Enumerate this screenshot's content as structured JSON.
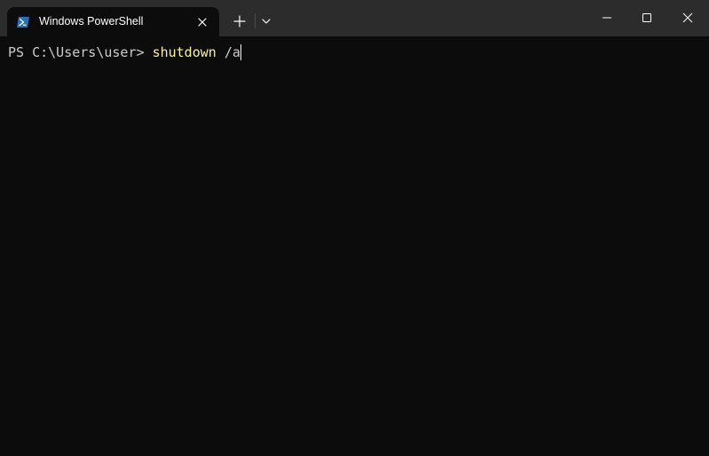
{
  "tab": {
    "title": "Windows PowerShell",
    "icon": "powershell-icon"
  },
  "toolbar": {
    "new_tab_icon": "plus-icon",
    "dropdown_icon": "chevron-down-icon"
  },
  "window_controls": {
    "minimize_icon": "minimize-icon",
    "maximize_icon": "maximize-icon",
    "close_icon": "close-icon"
  },
  "terminal": {
    "prompt": "PS C:\\Users\\user> ",
    "command": "shutdown",
    "argument": " /a"
  },
  "colors": {
    "titlebar": "#2c2c2c",
    "background": "#0c0c0c",
    "command": "#f9f1a5",
    "text": "#cccccc",
    "accent": "#1f6fd1"
  }
}
